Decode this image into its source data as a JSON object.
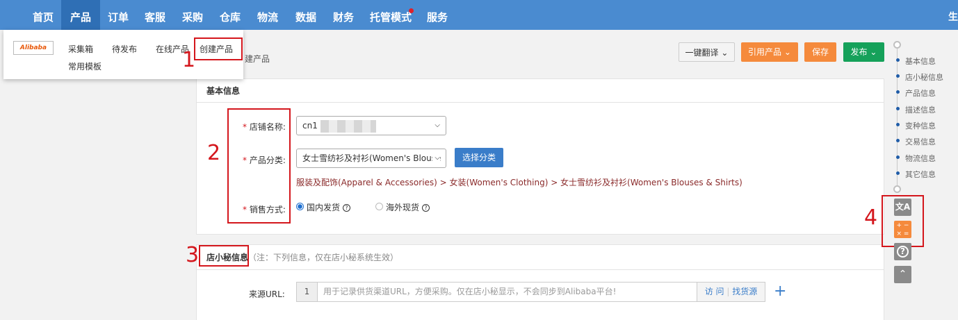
{
  "nav": {
    "items": [
      "首页",
      "产品",
      "订单",
      "客服",
      "采购",
      "仓库",
      "物流",
      "数据",
      "财务",
      "托管模式",
      "服务"
    ],
    "active_index": 1,
    "right_text": "生"
  },
  "dropdown": {
    "logo": "Alibaba",
    "items": [
      "采集箱",
      "待发布",
      "在线产品",
      "创建产品",
      "常用模板"
    ]
  },
  "breadcrumb": "建产品",
  "actions": {
    "translate": "一键翻译",
    "reference": "引用产品",
    "save": "保存",
    "publish": "发布"
  },
  "annotations": [
    "1",
    "2",
    "3",
    "4"
  ],
  "basic": {
    "title": "基本信息",
    "store_label": "店铺名称:",
    "store_value": "cn1",
    "category_label": "产品分类:",
    "category_value": "女士雪纺衫及衬衫(Women's Blouse",
    "choose_category": "选择分类",
    "category_path": "服装及配饰(Apparel & Accessories)  > 女装(Women's Clothing)  > 女士雪纺衫及衬衫(Women's Blouses & Shirts)",
    "sale_label": "销售方式:",
    "sale_options": [
      "国内发货",
      "海外现货"
    ],
    "sale_selected": 0
  },
  "secretary": {
    "title": "店小秘信息",
    "note": "（注：下列信息，仅在店小秘系统生效）",
    "source_label": "来源URL:",
    "source_index": "1",
    "source_placeholder": "用于记录供货渠道URL，方便采购。仅在店小秘显示，不会同步到Alibaba平台!",
    "visit": "访 问",
    "find_supply": "找货源",
    "add": "+"
  },
  "anchors": [
    "基本信息",
    "店小秘信息",
    "产品信息",
    "描述信息",
    "变种信息",
    "交易信息",
    "物流信息",
    "其它信息"
  ],
  "tools": [
    "translate-icon",
    "calculator-icon",
    "help-icon",
    "back-to-top-icon"
  ],
  "colors": {
    "nav": "#4a8bd0",
    "orange": "#f58a3c",
    "green": "#15a15a",
    "blue": "#3a7dc9",
    "annotation": "#d4161c",
    "link": "#8a2a2a"
  }
}
